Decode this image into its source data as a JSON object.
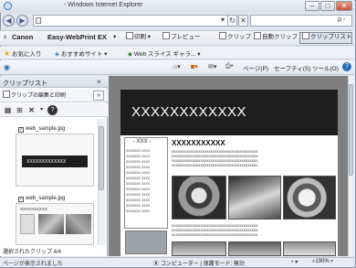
{
  "window": {
    "title": "- Windows Internet Explorer",
    "minimize_label": "–",
    "maximize_label": "□",
    "close_label": "✕"
  },
  "address_bar": {
    "refresh_label": "↻",
    "stop_label": "✕",
    "search_label": "ρ -"
  },
  "canon_toolbar": {
    "close_label": "x",
    "brand": "Canon",
    "product": "Easy-WebPrint EX",
    "print_label": "印刷",
    "preview_label": "プレビュー",
    "clip_label": "クリップ",
    "auto_clip_label": "自動クリップ",
    "clip_list_label": "クリップリスト"
  },
  "favorites_bar": {
    "favorites_label": "お気に入り",
    "suggested_sites_label": "おすすめサイト",
    "web_slice_label": "Web スライス ギャラ..."
  },
  "command_bar": {
    "page_label": "ページ(P)",
    "safety_label": "セーフティ(S)",
    "tools_label": "ツール(O)",
    "help_label": "?"
  },
  "clip_pane": {
    "title": "クリップリスト",
    "close_label": "×",
    "edit_print_label": "クリップの編集と印刷",
    "expand_label": "»",
    "items": [
      {
        "name": "web_sample.jpg",
        "preview_text": "XXXXXXXXXXXXX"
      },
      {
        "name": "web_sample.jpg",
        "preview_text": "XXXXXXXXXX"
      }
    ],
    "selected_count": "選択されたクリップ 4/4"
  },
  "content": {
    "banner_text": "XXXXXXXXXXXX",
    "sidebar_heading": "- XXX -",
    "heading": "XXXXXXXXXXX",
    "body_line": "xxxxxxxxxxxxxxxxxxxxxxxxxxxxxxxxxxxxxxxxxx",
    "side_line": "xxxxxxx   xxxx"
  },
  "status_bar": {
    "left_text": "ページが表示されました",
    "zone_text": "コンピューター | 保護モード: 無効",
    "zoom_text": "190%"
  },
  "colors": {
    "banner_bg": "#1e1e1e",
    "frame": "#dfe6ef",
    "viewer_bg": "#7f7f7f"
  }
}
